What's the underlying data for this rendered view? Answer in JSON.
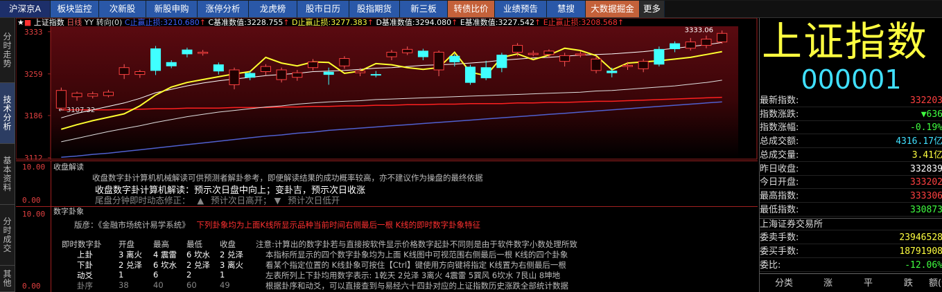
{
  "menu": [
    {
      "label": "沪深京A",
      "w": 73,
      "style": "first"
    },
    {
      "label": "板块监控",
      "w": 70
    },
    {
      "label": "次新股",
      "w": 68
    },
    {
      "label": "新股申购",
      "w": 74
    },
    {
      "label": "涨停分析",
      "w": 74
    },
    {
      "label": "龙虎榜",
      "w": 70
    },
    {
      "label": "股市日历",
      "w": 75
    },
    {
      "label": "股指期货",
      "w": 73
    },
    {
      "label": "新三板",
      "w": 69
    },
    {
      "label": "转债比价",
      "w": 68,
      "style": "orange"
    },
    {
      "label": "业绩预告",
      "w": 75
    },
    {
      "label": "慧搜",
      "w": 56
    },
    {
      "label": "大数据掘金",
      "w": 78,
      "style": "orange"
    },
    {
      "label": "更多",
      "w": 36,
      "style": "more"
    }
  ],
  "left_tabs": [
    {
      "label": "分时走势",
      "active": false
    },
    {
      "label": "技术分析",
      "active": true
    },
    {
      "label": "基本资料",
      "active": false
    },
    {
      "label": "分时成交",
      "active": false
    },
    {
      "label": "其他",
      "active": false
    }
  ],
  "chart_header": {
    "index_name": "上证指数",
    "period": "日线",
    "yy": "YY",
    "direction": "转向(0)",
    "c_label": "C止赢止损:",
    "c_value": "3210.680",
    "c_base_label": "C基准数值:",
    "c_base_value": "3228.755",
    "d_label": "D止赢止损:",
    "d_value": "3277.383",
    "d_base_label": "D基准数值:",
    "d_base_value": "3294.080",
    "e_base_label": "E基准数值:",
    "e_base_value": "3227.542",
    "e_label": "E止赢止损:",
    "e_value": "3208.568"
  },
  "chart_data": {
    "type": "candlestick",
    "y_ticks": [
      "3333",
      "3259",
      "3186",
      "3112"
    ],
    "ylim": [
      3112,
      3340
    ],
    "annot_low": "3107.32",
    "annot_high": "3333.06",
    "candles": [
      [
        3199,
        3230,
        3195,
        3235
      ],
      [
        3219,
        3225,
        3212,
        3228
      ],
      [
        3220,
        3224,
        3216,
        3228
      ],
      [
        3221,
        3227,
        3218,
        3231
      ],
      [
        3258,
        3270,
        3250,
        3276
      ],
      [
        3258,
        3263,
        3252,
        3266
      ],
      [
        3303,
        3265,
        3257,
        3308
      ],
      [
        3279,
        3273,
        3269,
        3283
      ],
      [
        3301,
        3294,
        3288,
        3305
      ],
      [
        3295,
        3297,
        3291,
        3301
      ],
      [
        3275,
        3264,
        3258,
        3279
      ],
      [
        3240,
        3266,
        3232,
        3270
      ],
      [
        3260,
        3253,
        3248,
        3264
      ],
      [
        3263,
        3272,
        3257,
        3276
      ],
      [
        3249,
        3266,
        3244,
        3270
      ],
      [
        3253,
        3261,
        3247,
        3266
      ],
      [
        3270,
        3280,
        3265,
        3285
      ],
      [
        3262,
        3258,
        3240,
        3270
      ],
      [
        3273,
        3286,
        3268,
        3290
      ],
      [
        3261,
        3264,
        3255,
        3269
      ],
      [
        3258,
        3257,
        3253,
        3264
      ],
      [
        3289,
        3297,
        3283,
        3301
      ],
      [
        3296,
        3302,
        3292,
        3307
      ],
      [
        3299,
        3289,
        3283,
        3303
      ],
      [
        3266,
        3297,
        3255,
        3300
      ],
      [
        3290,
        3280,
        3272,
        3294
      ],
      [
        3271,
        3244,
        3240,
        3275
      ],
      [
        3270,
        3252,
        3248,
        3282
      ],
      [
        3292,
        3270,
        3262,
        3296
      ],
      [
        3297,
        3309,
        3290,
        3313
      ],
      [
        3293,
        3295,
        3290,
        3300
      ],
      [
        3293,
        3299,
        3287,
        3302
      ],
      [
        3281,
        3291,
        3272,
        3296
      ],
      [
        3292,
        3294,
        3288,
        3299
      ],
      [
        3265,
        3285,
        3260,
        3289
      ],
      [
        3264,
        3261,
        3253,
        3270
      ],
      [
        3272,
        3274,
        3266,
        3280
      ],
      [
        3268,
        3281,
        3262,
        3285
      ],
      [
        3302,
        3276,
        3272,
        3307
      ],
      [
        3312,
        3303,
        3297,
        3316
      ],
      [
        3304,
        3315,
        3300,
        3322
      ],
      [
        3309,
        3320,
        3304,
        3326
      ],
      [
        3315,
        3330,
        3312,
        3335
      ]
    ],
    "ma_yellow": [
      3162,
      3170,
      3177,
      3183,
      3189,
      3203,
      3222,
      3236,
      3244,
      3249,
      3254,
      3259,
      3263,
      3288,
      3278,
      3273,
      3280,
      3279,
      3260,
      3264,
      3277,
      3275,
      3270,
      3267,
      3270,
      3297,
      3262,
      3256,
      3288,
      3294,
      3284,
      3292,
      3304,
      3300,
      3291,
      3266,
      3278,
      3280,
      3282,
      3285,
      3288,
      3293,
      3298
    ],
    "ma_white": [
      3182,
      3190,
      3196,
      3202,
      3208,
      3216,
      3226,
      3232,
      3238,
      3243,
      3247,
      3250,
      3253,
      3256,
      3258,
      3260,
      3263,
      3264,
      3265,
      3267,
      3269,
      3270,
      3272,
      3274,
      3275,
      3276,
      3278,
      3280,
      3283,
      3285,
      3287,
      3288,
      3290,
      3292,
      3293,
      3294,
      3296,
      3298,
      3301,
      3304,
      3307,
      3310,
      3314
    ],
    "ma_white2": [
      3140,
      3146,
      3152,
      3158,
      3163,
      3168,
      3174,
      3179,
      3184,
      3188,
      3192,
      3195,
      3198,
      3201,
      3203,
      3206,
      3208,
      3210,
      3211,
      3212,
      3214,
      3215,
      3216,
      3217,
      3218,
      3219,
      3220,
      3221,
      3222,
      3223,
      3224,
      3225,
      3226,
      3227,
      3229,
      3230,
      3232,
      3234,
      3236,
      3238,
      3241,
      3244,
      3248
    ],
    "ma_red": [
      3196,
      3196,
      3196,
      3196,
      3197,
      3197,
      3198,
      3198,
      3199,
      3199,
      3199,
      3200,
      3200,
      3200,
      3201,
      3201,
      3202,
      3202,
      3203,
      3203,
      3204,
      3204,
      3205,
      3205,
      3206,
      3206,
      3207,
      3207,
      3207,
      3208,
      3208,
      3209,
      3209,
      3210,
      3211,
      3211,
      3212,
      3213,
      3214,
      3215,
      3216,
      3217,
      3218
    ],
    "ma_blue": [
      3113,
      3115,
      3118,
      3120,
      3123,
      3126,
      3129,
      3132,
      3135,
      3138,
      3141,
      3144,
      3147,
      3150,
      3152,
      3155,
      3157,
      3160,
      3162,
      3164,
      3166,
      3168,
      3170,
      3172,
      3174,
      3176,
      3178,
      3180,
      3182,
      3184,
      3186,
      3188,
      3190,
      3192,
      3194,
      3196,
      3198,
      3200,
      3202,
      3204,
      3206,
      3208,
      3210
    ]
  },
  "panel1": {
    "title": "收盘解读",
    "y_top": "10.00",
    "y_bottom": "0.00",
    "line1": "收盘数字卦计算机机械解读可供预测者解卦参考，即便解读结果的成功概率较高，亦不建议作为操盘的最终依据",
    "line2": "收盘数字卦计算机解读：预示次日盘中向上；变卦吉，预示次日收涨",
    "line3_prefix": "尾盘分钟即时动态修正：",
    "line3_up": "▲",
    "line3_up_text": "预计次日高开；",
    "line3_down": "▼",
    "line3_down_text": "预计次日低开"
  },
  "panel2": {
    "title": "数字卦象",
    "y_top": "10.00",
    "y_bottom": "0.00",
    "intro": "版彦：《金融市场统计易学系统》",
    "intro_red": "下列卦象均为上面K线所显示品种当前时间右侧最后一根 K线的即时数字卦象特征",
    "table_header": [
      "即时数字卦",
      "开盘",
      "最高",
      "最低",
      "收盘"
    ],
    "rows": [
      [
        "上卦",
        "3 离火",
        "4 震雷",
        "6 坎水",
        "2 兑泽"
      ],
      [
        "下卦",
        "2 兑泽",
        "6 坎水",
        "2 兑泽",
        "3 离火"
      ],
      [
        "动爻",
        "1",
        "6",
        "2",
        "1"
      ],
      [
        "卦序",
        "38",
        "40",
        "60",
        "49"
      ]
    ],
    "note": [
      "注意:计算出的数字卦若与直接按软件显示价格数字起卦不同则是由于软件数字小数处理所致",
      "本指标所显示的四个数字卦象均为上面 K线图中可视范围右侧最后一根 K线的四个卦象",
      "看某个指定位置的 K线卦象可按住【Ctrl】键使用方向键将指定 K线置为右侧最后一根",
      "左表所列上下卦均用数字表示: 1乾天 2兑泽 3离火 4震雷 5巽风 6坎水 7艮山 8坤地",
      "根据卦序和动爻，可以直接查到与易经六十四卦对应的上证指数历史涨跌全部统计数据"
    ]
  },
  "right": {
    "title": "上证指数",
    "code": "000001",
    "rows": [
      {
        "label": "最新指数:",
        "value": "332203",
        "color": "#ff4040"
      },
      {
        "label": "指数涨跌:",
        "value": "▼636",
        "color": "#40ff40"
      },
      {
        "label": "指数涨幅:",
        "value": "-0.19%",
        "color": "#40ff40"
      },
      {
        "label": "总成交额:",
        "value": "4316.17亿",
        "color": "#40e0ff"
      },
      {
        "label": "总成交量:",
        "value": "3.41亿",
        "color": "#ffff40"
      },
      {
        "label": "昨日收盘:",
        "value": "332839",
        "color": "#ffffff"
      },
      {
        "label": "今日开盘:",
        "value": "333202",
        "color": "#ff4040"
      },
      {
        "label": "最高指数:",
        "value": "333306",
        "color": "#ff4040"
      },
      {
        "label": "最低指数:",
        "value": "330873",
        "color": "#40ff40"
      }
    ],
    "exchange": "上海证券交易所",
    "rows2": [
      {
        "label": "委卖手数:",
        "value": "23946528",
        "color": "#ffff40"
      },
      {
        "label": "委买手数:",
        "value": "18791908",
        "color": "#ffff40"
      },
      {
        "label": "委比:",
        "value": "-12.06%",
        "color": "#40ff40"
      }
    ],
    "bottom_tabs": [
      "分类",
      "涨",
      "平",
      "跌",
      "额(亿)"
    ]
  }
}
